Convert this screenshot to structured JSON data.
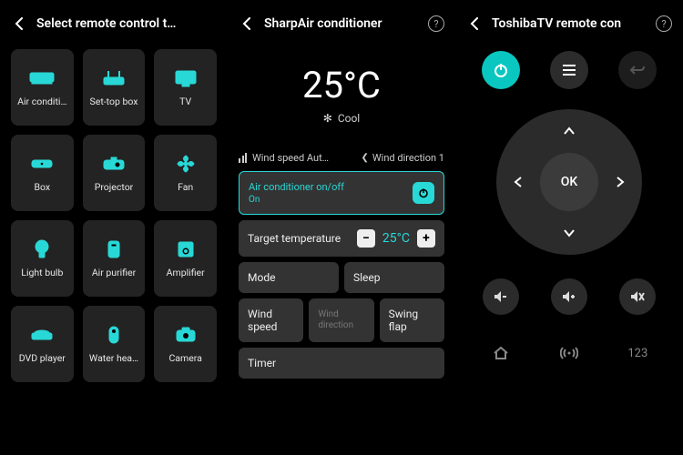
{
  "accent": "#28d8d6",
  "panel1": {
    "title": "Select remote control t…",
    "tiles": [
      {
        "label": "Air conditi…",
        "icon": "air-conditioner-icon"
      },
      {
        "label": "Set-top box",
        "icon": "router-icon"
      },
      {
        "label": "TV",
        "icon": "tv-icon"
      },
      {
        "label": "Box",
        "icon": "media-box-icon"
      },
      {
        "label": "Projector",
        "icon": "projector-icon"
      },
      {
        "label": "Fan",
        "icon": "fan-icon"
      },
      {
        "label": "Light bulb",
        "icon": "bulb-icon"
      },
      {
        "label": "Air purifier",
        "icon": "air-purifier-icon"
      },
      {
        "label": "Amplifier",
        "icon": "amplifier-icon"
      },
      {
        "label": "DVD player",
        "icon": "dvd-icon"
      },
      {
        "label": "Water hea…",
        "icon": "water-heater-icon"
      },
      {
        "label": "Camera",
        "icon": "camera-icon"
      }
    ]
  },
  "panel2": {
    "title": "SharpAir conditioner",
    "temperature": "25°C",
    "mode_label": "Cool",
    "wind_speed_text": "Wind speed Aut…",
    "wind_dir_text": "Wind direction 1",
    "onoff": {
      "label": "Air conditioner on/off",
      "state": "On"
    },
    "target": {
      "label": "Target temperature",
      "value": "25°C"
    },
    "buttons": {
      "mode": "Mode",
      "sleep": "Sleep",
      "wind_speed": "Wind speed",
      "wind_direction": "Wind\ndirection",
      "swing": "Swing flap",
      "timer": "Timer"
    }
  },
  "panel3": {
    "title": "ToshibaTV remote con",
    "ok": "OK",
    "numpad": "123"
  }
}
